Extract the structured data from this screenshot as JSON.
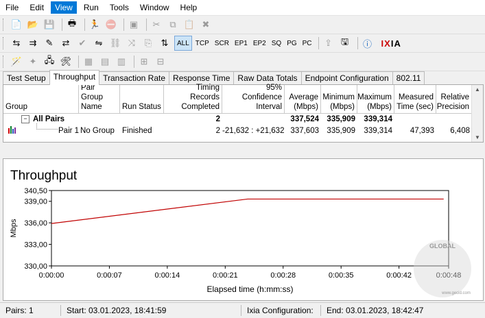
{
  "menu": {
    "file": "File",
    "edit": "Edit",
    "view": "View",
    "run": "Run",
    "tools": "Tools",
    "window": "Window",
    "help": "Help"
  },
  "toolbar2": {
    "all": "ALL",
    "tcp": "TCP",
    "scr": "SCR",
    "ep1": "EP1",
    "ep2": "EP2",
    "sq": "SQ",
    "pg": "PG",
    "pc": "PC",
    "brand_i": "I",
    "brand_x": "X",
    "brand_ia": "IA"
  },
  "tabs": [
    "Test Setup",
    "Throughput",
    "Transaction Rate",
    "Response Time",
    "Raw Data Totals",
    "Endpoint Configuration",
    "802.11"
  ],
  "grid": {
    "headers": {
      "group": "Group",
      "pair_group_name_1": "Pair Group",
      "pair_group_name_2": "Name",
      "run_status": "Run Status",
      "timing_1": "Timing Records",
      "timing_2": "Completed",
      "conf_1": "95% Confidence",
      "conf_2": "Interval",
      "avg_1": "Average",
      "avg_2": "(Mbps)",
      "min_1": "Minimum",
      "min_2": "(Mbps)",
      "max_1": "Maximum",
      "max_2": "(Mbps)",
      "meas_1": "Measured",
      "meas_2": "Time (sec)",
      "rel_1": "Relative",
      "rel_2": "Precision"
    },
    "all_pairs": {
      "label": "All Pairs",
      "timing": "2",
      "average": "337,524",
      "minimum": "335,909",
      "maximum": "339,314"
    },
    "pair1": {
      "label": "Pair 1",
      "group_name": "No Group",
      "status": "Finished",
      "timing": "2",
      "confidence": "-21,632 : +21,632",
      "average": "337,603",
      "minimum": "335,909",
      "maximum": "339,314",
      "measured": "47,393",
      "precision": "6,408"
    }
  },
  "chart_data": {
    "type": "line",
    "title": "Throughput",
    "xlabel": "Elapsed time (h:mm:ss)",
    "ylabel": "Mbps",
    "ylim": [
      330.0,
      340.5
    ],
    "xlim": [
      0,
      48
    ],
    "yticks": [
      "330,00",
      "333,00",
      "336,00",
      "339,00",
      "340,50"
    ],
    "ytick_values": [
      330.0,
      333.0,
      336.0,
      339.0,
      340.5
    ],
    "xticks": [
      "0:00:00",
      "0:00:07",
      "0:00:14",
      "0:00:21",
      "0:00:28",
      "0:00:35",
      "0:00:42",
      "0:00:48"
    ],
    "xtick_values": [
      0,
      7,
      14,
      21,
      28,
      35,
      42,
      48
    ],
    "series": [
      {
        "color": "#c00000",
        "x": [
          0,
          23.7,
          47.4
        ],
        "y": [
          335.909,
          339.314,
          339.314
        ]
      }
    ],
    "grid": false
  },
  "status": {
    "pairs": "Pairs: 1",
    "start": "Start: 03.01.2023, 18:41:59",
    "ixia_conf": "Ixia Configuration:",
    "end": "End: 03.01.2023, 18:42:47"
  },
  "watermark": {
    "g": "GLOBAL",
    "url": "www.gecid.com"
  }
}
